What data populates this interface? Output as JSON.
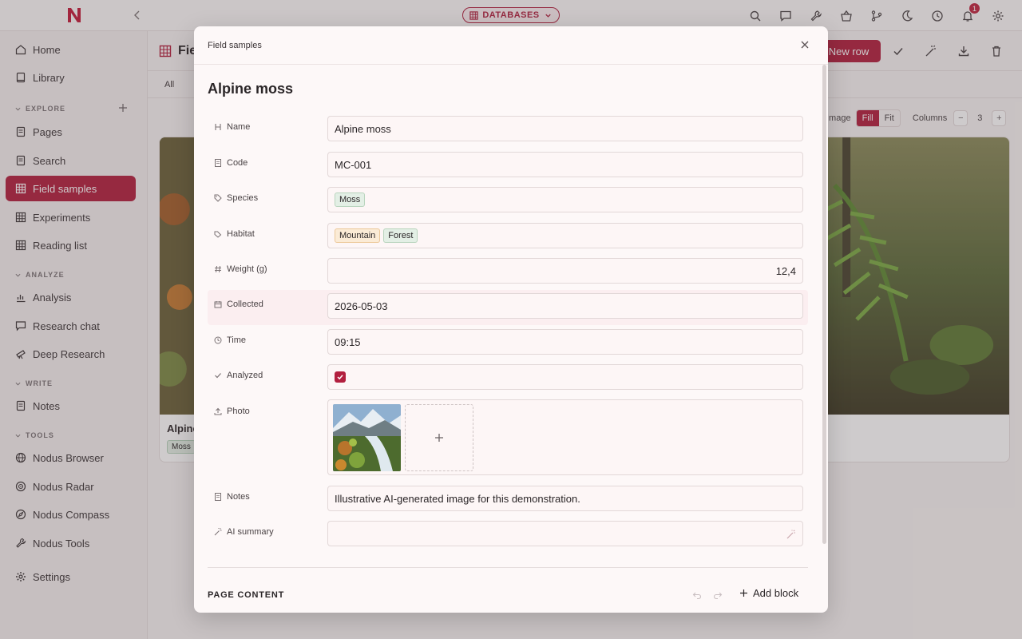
{
  "topbar": {
    "databases_label": "DATABASES",
    "notification_count": "1"
  },
  "sidebar": {
    "top_items": [
      {
        "label": "Home",
        "icon": "home-icon"
      },
      {
        "label": "Library",
        "icon": "book-icon"
      }
    ],
    "sections": [
      {
        "label": "EXPLORE",
        "items": [
          "Pages",
          "Search",
          "Field samples",
          "Experiments",
          "Reading list"
        ]
      },
      {
        "label": "ANALYZE",
        "items": [
          "Analysis",
          "Research chat",
          "Deep Research"
        ]
      },
      {
        "label": "WRITE",
        "items": [
          "Notes"
        ]
      },
      {
        "label": "TOOLS",
        "items": [
          "Nodus Browser",
          "Nodus Radar",
          "Nodus Compass",
          "Nodus Tools"
        ]
      }
    ],
    "settings_label": "Settings",
    "active_item": "Field samples",
    "accent_color": "#b21f3e"
  },
  "background_page": {
    "title": "Fiel",
    "new_row_label": "New row",
    "view_tab_all": "All",
    "gallery": {
      "image_label": "Image",
      "fill_label": "Fill",
      "fit_label": "Fit",
      "columns_label": "Columns",
      "columns_value": "3",
      "minus": "−",
      "plus": "+"
    },
    "card_left": {
      "title": "Alpine",
      "tag": "Moss"
    }
  },
  "modal": {
    "breadcrumb": "Field samples",
    "title": "Alpine moss",
    "fields": {
      "name": {
        "label": "Name",
        "value": "Alpine moss"
      },
      "code": {
        "label": "Code",
        "value": "MC-001"
      },
      "species": {
        "label": "Species",
        "tags": [
          "Moss"
        ]
      },
      "habitat": {
        "label": "Habitat",
        "tags": [
          "Mountain",
          "Forest"
        ]
      },
      "weight": {
        "label": "Weight (g)",
        "value": "12,4"
      },
      "collected": {
        "label": "Collected",
        "value": "2026-05-03"
      },
      "time": {
        "label": "Time",
        "value": "09:15"
      },
      "analyzed": {
        "label": "Analyzed",
        "checked": true
      },
      "photo": {
        "label": "Photo"
      },
      "notes": {
        "label": "Notes",
        "value": "Illustrative AI-generated image for this demonstration."
      },
      "ai_summary": {
        "label": "AI summary",
        "value": ""
      }
    },
    "page_content_label": "PAGE CONTENT",
    "add_block_label": "Add block"
  }
}
